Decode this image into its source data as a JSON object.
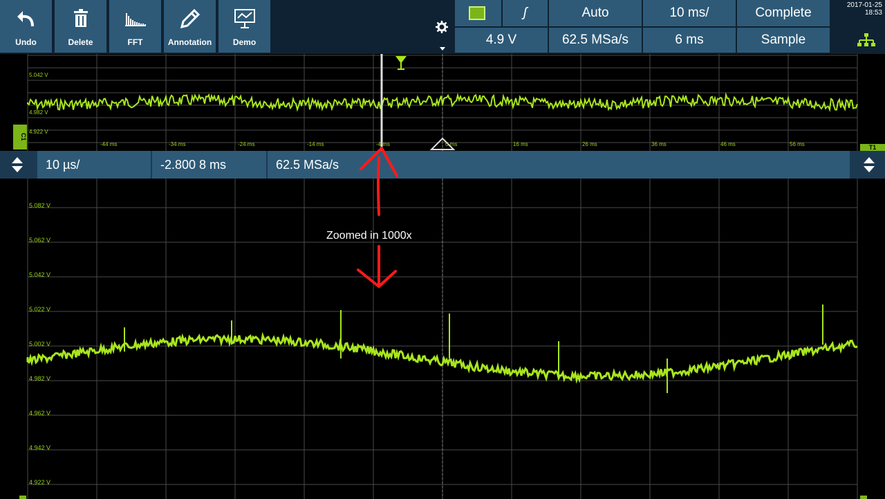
{
  "toolbar": {
    "buttons": [
      {
        "label": "Undo",
        "icon": "undo-icon"
      },
      {
        "label": "Delete",
        "icon": "trash-icon"
      },
      {
        "label": "FFT",
        "icon": "fft-icon"
      },
      {
        "label": "Annotation",
        "icon": "pencil-icon"
      },
      {
        "label": "Demo",
        "icon": "demo-icon"
      }
    ],
    "settings_icon": "gear-icon"
  },
  "acquisition": {
    "trigger_slope": "ʃ",
    "trigger_mode": "Auto",
    "timebase": "10 ms/",
    "acq_state": "Complete",
    "trigger_level": "4.9 V",
    "sample_rate": "62.5 MSa/s",
    "horiz_position": "6 ms",
    "acq_mode": "Sample"
  },
  "clock": {
    "date": "2017-01-25",
    "time": "18:53"
  },
  "overview": {
    "y_labels": [
      "5.042 V",
      "4.982 V",
      "4.922 V"
    ],
    "x_labels": [
      "-44 ms",
      "-34 ms",
      "-24 ms",
      "-14 ms",
      "-4 ms",
      "6 ms",
      "16 ms",
      "26 ms",
      "36 ms",
      "46 ms",
      "56 ms"
    ],
    "channel_marker": "C1",
    "trigger_marker": "T"
  },
  "zoom_bar": {
    "timebase": "10 µs/",
    "position": "-2.800 8 ms",
    "sample_rate": "62.5 MSa/s",
    "t_marker": "T1"
  },
  "main": {
    "y_labels": [
      "5.082 V",
      "5.062 V",
      "5.042 V",
      "5.022 V",
      "5.002 V",
      "4.982 V",
      "4.962 V",
      "4.942 V",
      "4.922 V"
    ],
    "annotation": "Zoomed in 1000x"
  },
  "colors": {
    "trace": "#a8e61d",
    "toolbar": "#2e5a78",
    "grid": "#4a4a4a",
    "annotation_arrow": "#ff1a1a"
  }
}
